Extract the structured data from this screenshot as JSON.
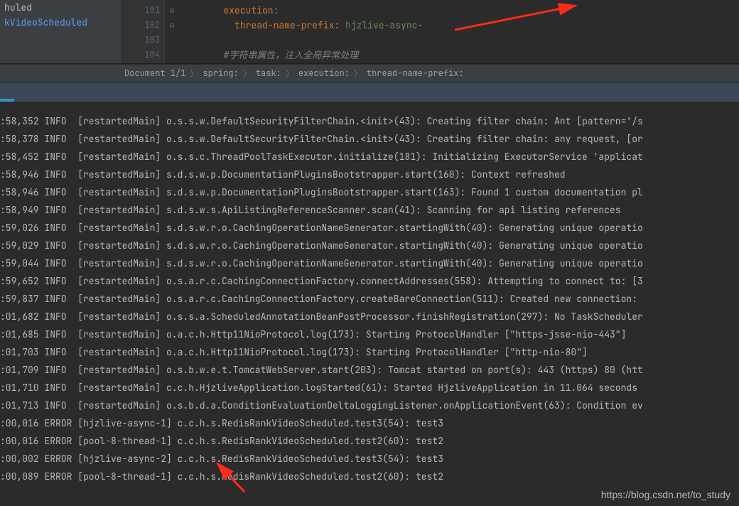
{
  "tree": {
    "items": [
      {
        "label": "huled",
        "cls": "plain"
      },
      {
        "label": "kVideoScheduled",
        "cls": ""
      }
    ]
  },
  "editor": {
    "lines": [
      101,
      102,
      103,
      104
    ],
    "code": [
      {
        "indent": "        ",
        "key": "execution",
        "sep": ":",
        "val": ""
      },
      {
        "indent": "          ",
        "key": "thread-name-prefix",
        "sep": ": ",
        "val": "hjzlive-async-"
      },
      {
        "indent": "",
        "key": "",
        "sep": "",
        "val": ""
      },
      {
        "indent": "        ",
        "comment": "#字符串属性，注入全局异常处理"
      }
    ]
  },
  "breadcrumbs": [
    "Document 1/1",
    "spring:",
    "task:",
    "execution:",
    "thread-name-prefix:"
  ],
  "logs": [
    {
      "time": ":58,352",
      "lvl": "INFO",
      "thread": "[restartedMain]",
      "msg": "o.s.s.w.DefaultSecurityFilterChain.<init>(43): Creating filter chain: Ant [pattern='/s"
    },
    {
      "time": ":58,378",
      "lvl": "INFO",
      "thread": "[restartedMain]",
      "msg": "o.s.s.w.DefaultSecurityFilterChain.<init>(43): Creating filter chain: any request, [or"
    },
    {
      "time": ":58,452",
      "lvl": "INFO",
      "thread": "[restartedMain]",
      "msg": "o.s.s.c.ThreadPoolTaskExecutor.initialize(181): Initializing ExecutorService 'applicat"
    },
    {
      "time": ":58,946",
      "lvl": "INFO",
      "thread": "[restartedMain]",
      "msg": "s.d.s.w.p.DocumentationPluginsBootstrapper.start(160): Context refreshed"
    },
    {
      "time": ":58,946",
      "lvl": "INFO",
      "thread": "[restartedMain]",
      "msg": "s.d.s.w.p.DocumentationPluginsBootstrapper.start(163): Found 1 custom documentation pl"
    },
    {
      "time": ":58,949",
      "lvl": "INFO",
      "thread": "[restartedMain]",
      "msg": "s.d.s.w.s.ApiListingReferenceScanner.scan(41): Scanning for api listing references"
    },
    {
      "time": ":59,026",
      "lvl": "INFO",
      "thread": "[restartedMain]",
      "msg": "s.d.s.w.r.o.CachingOperationNameGenerator.startingWith(40): Generating unique operatio"
    },
    {
      "time": ":59,029",
      "lvl": "INFO",
      "thread": "[restartedMain]",
      "msg": "s.d.s.w.r.o.CachingOperationNameGenerator.startingWith(40): Generating unique operatio"
    },
    {
      "time": ":59,044",
      "lvl": "INFO",
      "thread": "[restartedMain]",
      "msg": "s.d.s.w.r.o.CachingOperationNameGenerator.startingWith(40): Generating unique operatio"
    },
    {
      "time": ":59,652",
      "lvl": "INFO",
      "thread": "[restartedMain]",
      "msg": "o.s.a.r.c.CachingConnectionFactory.connectAddresses(558): Attempting to connect to: [3"
    },
    {
      "time": ":59,837",
      "lvl": "INFO",
      "thread": "[restartedMain]",
      "msg": "o.s.a.r.c.CachingConnectionFactory.createBareConnection(511): Created new connection: "
    },
    {
      "time": ":01,682",
      "lvl": "INFO",
      "thread": "[restartedMain]",
      "msg": "o.s.s.a.ScheduledAnnotationBeanPostProcessor.finishRegistration(297): No TaskScheduler"
    },
    {
      "time": ":01,685",
      "lvl": "INFO",
      "thread": "[restartedMain]",
      "msg": "o.a.c.h.Http11NioProtocol.log(173): Starting ProtocolHandler [\"https-jsse-nio-443\"]"
    },
    {
      "time": ":01,703",
      "lvl": "INFO",
      "thread": "[restartedMain]",
      "msg": "o.a.c.h.Http11NioProtocol.log(173): Starting ProtocolHandler [\"http-nio-80\"]"
    },
    {
      "time": ":01,709",
      "lvl": "INFO",
      "thread": "[restartedMain]",
      "msg": "o.s.b.w.e.t.TomcatWebServer.start(203): Tomcat started on port(s): 443 (https) 80 (htt"
    },
    {
      "time": ":01,710",
      "lvl": "INFO",
      "thread": "[restartedMain]",
      "msg": "c.c.h.HjzliveApplication.logStarted(61): Started HjzliveApplication in 11.064 seconds "
    },
    {
      "time": ":01,713",
      "lvl": "INFO",
      "thread": "[restartedMain]",
      "msg": "o.s.b.d.a.ConditionEvaluationDeltaLoggingListener.onApplicationEvent(63): Condition ev"
    },
    {
      "time": ":00,016",
      "lvl": "ERROR",
      "thread": "[hjzlive-async-1]",
      "msg": "c.c.h.s.RedisRankVideoScheduled.test3(54): test3"
    },
    {
      "time": ":00,016",
      "lvl": "ERROR",
      "thread": "[pool-8-thread-1]",
      "msg": "c.c.h.s.RedisRankVideoScheduled.test2(60): test2"
    },
    {
      "time": ":00,002",
      "lvl": "ERROR",
      "thread": "[hjzlive-async-2]",
      "msg": "c.c.h.s.RedisRankVideoScheduled.test3(54): test3"
    },
    {
      "time": ":00,089",
      "lvl": "ERROR",
      "thread": "[pool-8-thread-1]",
      "msg": "c.c.h.s.RedisRankVideoScheduled.test2(60): test2"
    }
  ],
  "watermark": "https://blog.csdn.net/to_study"
}
